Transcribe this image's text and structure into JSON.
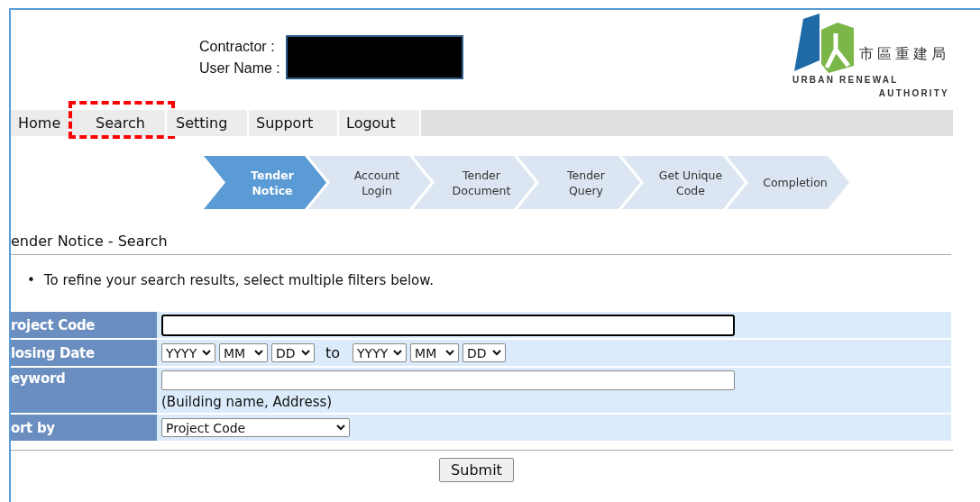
{
  "header": {
    "contractor_label": "Contractor :",
    "user_name_label": "User Name :",
    "logo": {
      "chinese": "市區重建局",
      "english_line_1": "URBAN RENEWAL",
      "english_line_2": "AUTHORITY"
    }
  },
  "nav": [
    {
      "label": "Home",
      "annotated": false
    },
    {
      "label": "Search",
      "annotated": true
    },
    {
      "label": "Setting",
      "annotated": false
    },
    {
      "label": "Support",
      "annotated": false
    },
    {
      "label": "Logout",
      "annotated": false
    }
  ],
  "steps": [
    {
      "label": "Tender Notice",
      "selected": true
    },
    {
      "label": "Account Login",
      "selected": false
    },
    {
      "label": "Tender Document",
      "selected": false
    },
    {
      "label": "Tender Query",
      "selected": false
    },
    {
      "label": "Get Unique Code",
      "selected": false
    },
    {
      "label": "Completion",
      "selected": false
    }
  ],
  "heading": "ender Notice - Search",
  "instructions": [
    {
      "bullet": "•",
      "text": "To refine your search results, select multiple filters below."
    }
  ],
  "form": [
    {
      "kind": "text",
      "label": "roject Code",
      "focused": true
    },
    {
      "kind": "date_range",
      "label": "losing Date",
      "from": [
        "YYYY",
        "MM",
        "DD"
      ],
      "separator": "to",
      "to": [
        "YYYY",
        "MM",
        "DD"
      ]
    },
    {
      "kind": "text_hint",
      "label": "eyword",
      "focused": false,
      "hint": "(Building name, Address)"
    },
    {
      "kind": "select",
      "label": "ort by",
      "value": "Project Code"
    }
  ],
  "submit": "Submit"
}
